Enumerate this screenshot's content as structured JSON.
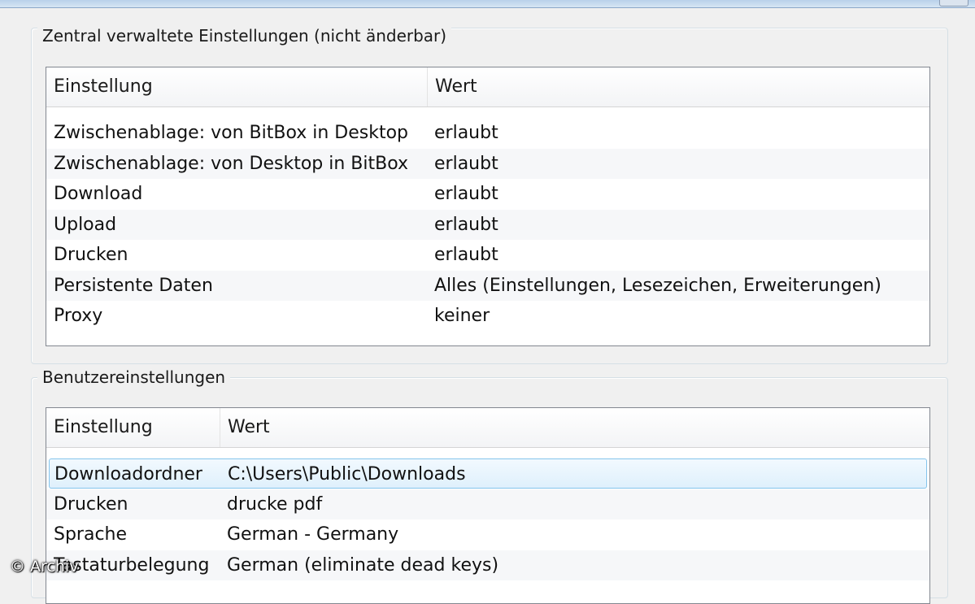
{
  "central_group": {
    "title": "Zentral verwaltete Einstellungen (nicht änderbar)",
    "columns": [
      "Einstellung",
      "Wert"
    ],
    "rows": [
      {
        "setting": "Zwischenablage: von BitBox in Desktop",
        "value": "erlaubt"
      },
      {
        "setting": "Zwischenablage: von Desktop in BitBox",
        "value": "erlaubt"
      },
      {
        "setting": "Download",
        "value": "erlaubt"
      },
      {
        "setting": "Upload",
        "value": "erlaubt"
      },
      {
        "setting": "Drucken",
        "value": "erlaubt"
      },
      {
        "setting": "Persistente Daten",
        "value": "Alles (Einstellungen, Lesezeichen, Erweiterungen)"
      },
      {
        "setting": "Proxy",
        "value": "keiner"
      }
    ]
  },
  "user_group": {
    "title": "Benutzereinstellungen",
    "columns": [
      "Einstellung",
      "Wert"
    ],
    "selected_row": "Downloadordner",
    "rows": [
      {
        "setting": "Downloadordner",
        "value": "C:\\Users\\Public\\Downloads"
      },
      {
        "setting": "Drucken",
        "value": "drucke pdf"
      },
      {
        "setting": "Sprache",
        "value": "German - Germany"
      },
      {
        "setting": "Tastaturbelegung",
        "value": "German (eliminate dead keys)"
      }
    ]
  },
  "watermark": "© Archiv",
  "colors": {
    "selection_border": "#84c4ec",
    "selection_fill": "#dff0fc",
    "listview_border": "#828790"
  }
}
